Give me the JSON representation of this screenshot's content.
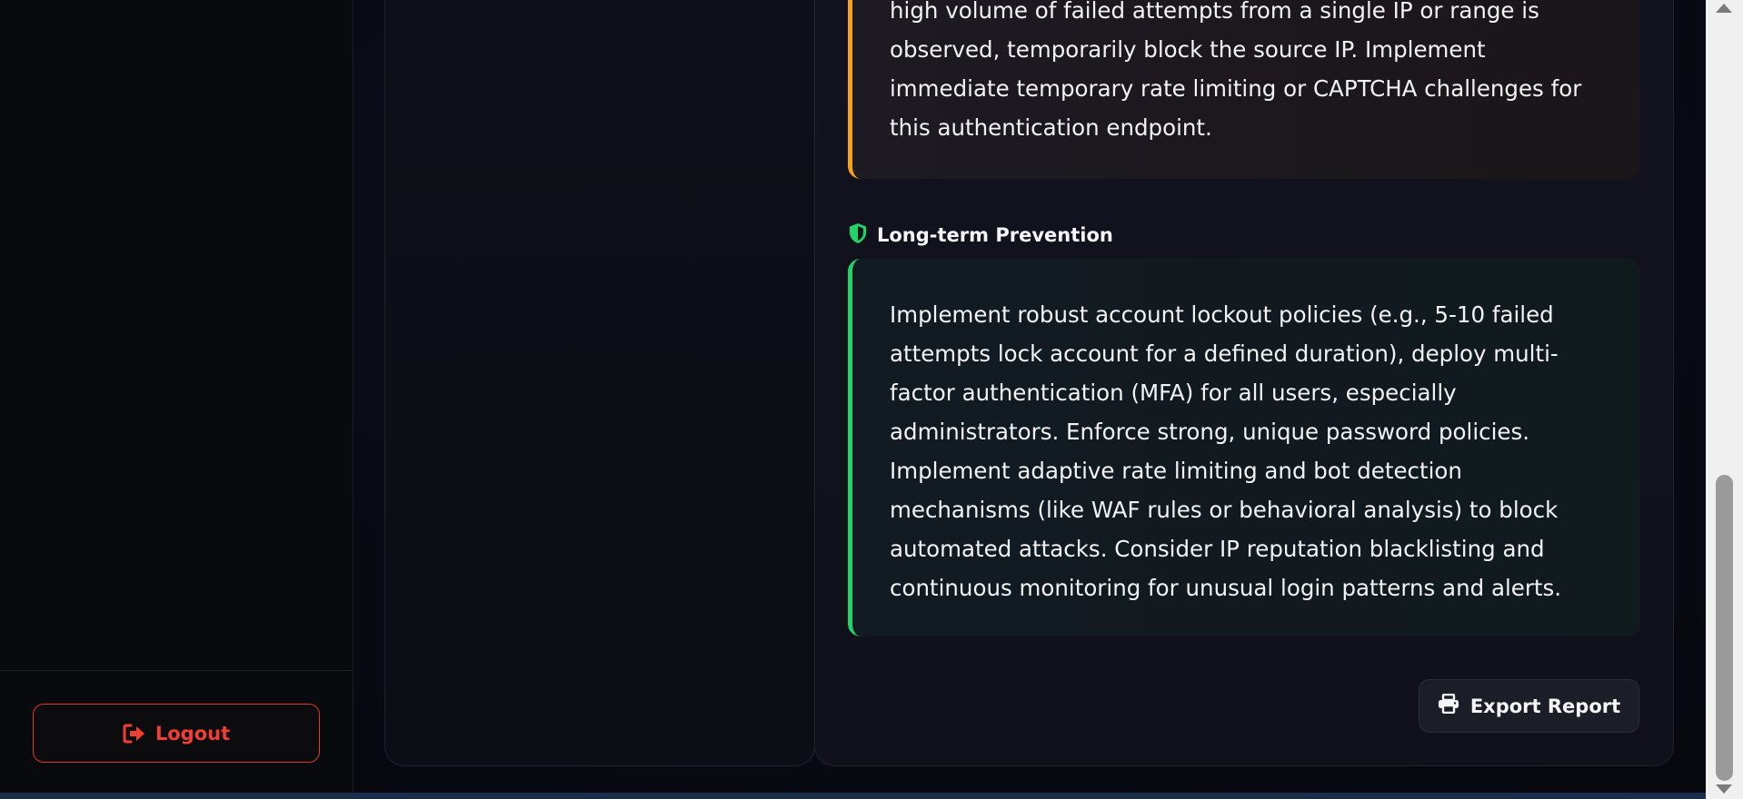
{
  "sidebar": {
    "logout_label": "Logout",
    "logout_icon": "sign-out-icon"
  },
  "report": {
    "immediate_action": {
      "text": "high volume of failed attempts from a single IP or range is observed, temporarily block the source IP. Implement immediate temporary rate limiting or CAPTCHA challenges for this authentication endpoint.",
      "accent_color": "#f5a313"
    },
    "long_term": {
      "heading": "Long-term Prevention",
      "icon": "shield-icon",
      "icon_color": "#22d36a",
      "text": "Implement robust account lockout policies (e.g., 5-10 failed attempts lock account for a defined duration), deploy multi-factor authentication (MFA) for all users, especially administrators. Enforce strong, unique password policies. Implement adaptive rate limiting and bot detection mechanisms (like WAF rules or behavioral analysis) to block automated attacks. Consider IP reputation blacklisting and continuous monitoring for unusual login patterns and alerts.",
      "accent_color": "#22d36a"
    },
    "export_label": "Export Report",
    "export_icon": "printer-icon"
  },
  "colors": {
    "danger": "#f03d35",
    "warning": "#f5a313",
    "success": "#22d36a"
  }
}
